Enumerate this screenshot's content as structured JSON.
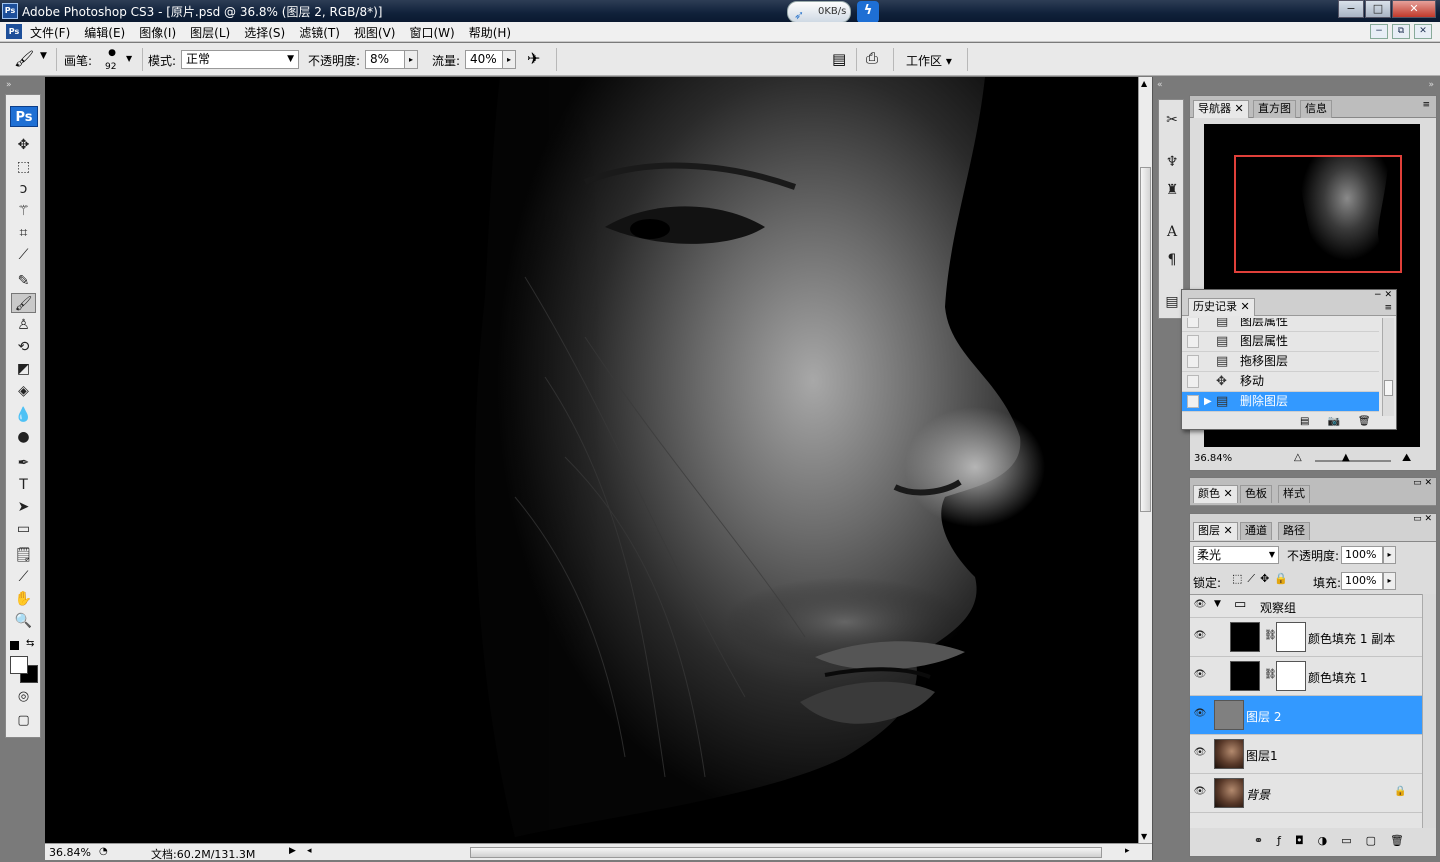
{
  "window": {
    "title": "Adobe Photoshop CS3 - [原片.psd @ 36.8% (图层 2, RGB/8*)]",
    "app_icon": "Ps",
    "net_speed": "0KB/s",
    "controls": {
      "minimize": "−",
      "maximize": "□",
      "close": "✕"
    }
  },
  "menubar": {
    "items": [
      "文件(F)",
      "编辑(E)",
      "图像(I)",
      "图层(L)",
      "选择(S)",
      "滤镜(T)",
      "视图(V)",
      "窗口(W)",
      "帮助(H)"
    ],
    "mdi": {
      "minimize": "−",
      "restore": "⧉",
      "close": "✕"
    }
  },
  "options": {
    "brush_label": "画笔:",
    "brush_size": "92",
    "mode_label": "模式:",
    "mode_value": "正常",
    "opacity_label": "不透明度:",
    "opacity_value": "8%",
    "flow_label": "流量:",
    "flow_value": "40%",
    "workspace_label": "工作区 ▾"
  },
  "toolbox": {
    "logo": "Ps",
    "tools": [
      {
        "name": "move-tool",
        "glyph": "✥"
      },
      {
        "name": "marquee-tool",
        "glyph": "⬚"
      },
      {
        "name": "lasso-tool",
        "glyph": "ↄ"
      },
      {
        "name": "magic-wand-tool",
        "glyph": "⚚"
      },
      {
        "name": "crop-tool",
        "glyph": "⌗"
      },
      {
        "name": "slice-tool",
        "glyph": "⟋"
      },
      {
        "name": "healing-brush-tool",
        "glyph": "✎"
      },
      {
        "name": "brush-tool",
        "glyph": "🖌"
      },
      {
        "name": "clone-stamp-tool",
        "glyph": "♙"
      },
      {
        "name": "history-brush-tool",
        "glyph": "⟲"
      },
      {
        "name": "eraser-tool",
        "glyph": "◩"
      },
      {
        "name": "paint-bucket-tool",
        "glyph": "◈"
      },
      {
        "name": "blur-tool",
        "glyph": "💧"
      },
      {
        "name": "dodge-tool",
        "glyph": "●"
      },
      {
        "name": "pen-tool",
        "glyph": "✒"
      },
      {
        "name": "type-tool",
        "glyph": "T"
      },
      {
        "name": "path-selection-tool",
        "glyph": "➤"
      },
      {
        "name": "shape-tool",
        "glyph": "▭"
      },
      {
        "name": "notes-tool",
        "glyph": "🗒"
      },
      {
        "name": "eyedropper-tool",
        "glyph": "⟋"
      },
      {
        "name": "hand-tool",
        "glyph": "✋"
      },
      {
        "name": "zoom-tool",
        "glyph": "🔍"
      }
    ],
    "active_tool": "brush-tool"
  },
  "status": {
    "zoom": "36.84%",
    "doc": "文档:60.2M/131.3M"
  },
  "navigator": {
    "tabs": [
      "导航器",
      "直方图",
      "信息"
    ],
    "zoom": "36.84%"
  },
  "color_panel": {
    "tabs": [
      "颜色",
      "色板",
      "样式"
    ]
  },
  "history": {
    "tab": "历史记录",
    "items": [
      {
        "label": "图层属性",
        "icon": "document-icon"
      },
      {
        "label": "图层属性",
        "icon": "document-icon"
      },
      {
        "label": "拖移图层",
        "icon": "document-icon"
      },
      {
        "label": "移动",
        "icon": "move-icon"
      },
      {
        "label": "删除图层",
        "icon": "document-icon"
      }
    ],
    "selected_index": 4
  },
  "layers": {
    "tabs": [
      "图层",
      "通道",
      "路径"
    ],
    "blend_mode": "柔光",
    "opacity_label": "不透明度:",
    "opacity_value": "100%",
    "lock_label": "锁定:",
    "fill_label": "填充:",
    "fill_value": "100%",
    "group_name": "观察组",
    "rows": [
      {
        "name": "颜色填充 1 副本",
        "type": "fill"
      },
      {
        "name": "颜色填充 1",
        "type": "fill"
      },
      {
        "name": "图层 2",
        "type": "gray"
      },
      {
        "name": "图层1",
        "type": "photo"
      },
      {
        "name": "背景",
        "type": "photo"
      }
    ],
    "selected_index": 2
  },
  "colors": {
    "selection": "#3399ff",
    "ps_blue": "#1e6fd4",
    "nav_rect": "#e0403a"
  }
}
